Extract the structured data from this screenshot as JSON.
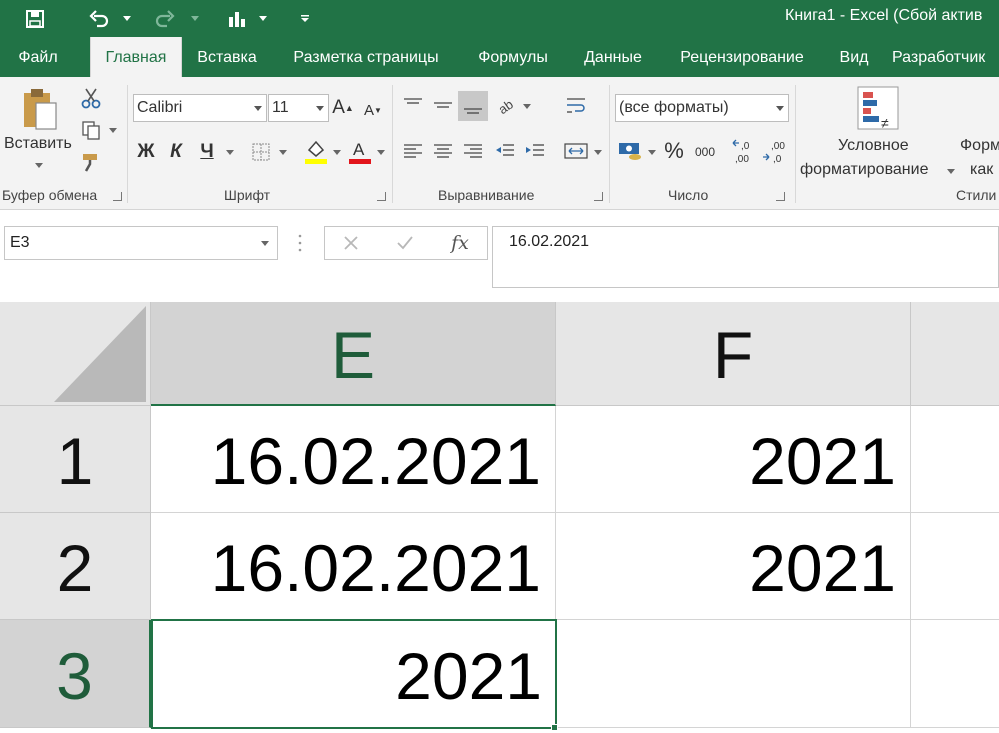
{
  "app": {
    "title": "Книга1 - Excel (Сбой актив"
  },
  "tabs": [
    {
      "label": "Файл"
    },
    {
      "label": "Главная"
    },
    {
      "label": "Вставка"
    },
    {
      "label": "Разметка страницы"
    },
    {
      "label": "Формулы"
    },
    {
      "label": "Данные"
    },
    {
      "label": "Рецензирование"
    },
    {
      "label": "Вид"
    },
    {
      "label": "Разработчик"
    }
  ],
  "ribbon": {
    "clipboard": {
      "paste_label": "Вставить",
      "group_label": "Буфер обмена"
    },
    "font": {
      "font_name": "Calibri",
      "font_size": "11",
      "bold": "Ж",
      "italic": "К",
      "underline": "Ч",
      "group_label": "Шрифт"
    },
    "alignment": {
      "group_label": "Выравнивание"
    },
    "number": {
      "format": "(все форматы)",
      "percent": "%",
      "thousands": "000",
      "group_label": "Число"
    },
    "styles": {
      "conditional_line1": "Условное",
      "conditional_line2": "форматирование",
      "format_table_line1": "Форм",
      "format_table_line2": "как",
      "group_label": "Стили"
    }
  },
  "formula_bar": {
    "name_box": "E3",
    "value": "16.02.2021"
  },
  "grid": {
    "columns": [
      "E",
      "F"
    ],
    "rows": [
      {
        "number": "1",
        "E": "16.02.2021",
        "F": "2021"
      },
      {
        "number": "2",
        "E": "16.02.2021",
        "F": "2021"
      },
      {
        "number": "3",
        "E": "2021",
        "F": ""
      }
    ],
    "active_cell": "E3"
  },
  "colors": {
    "brand": "#217346",
    "selection_text": "#1f5c3a"
  }
}
